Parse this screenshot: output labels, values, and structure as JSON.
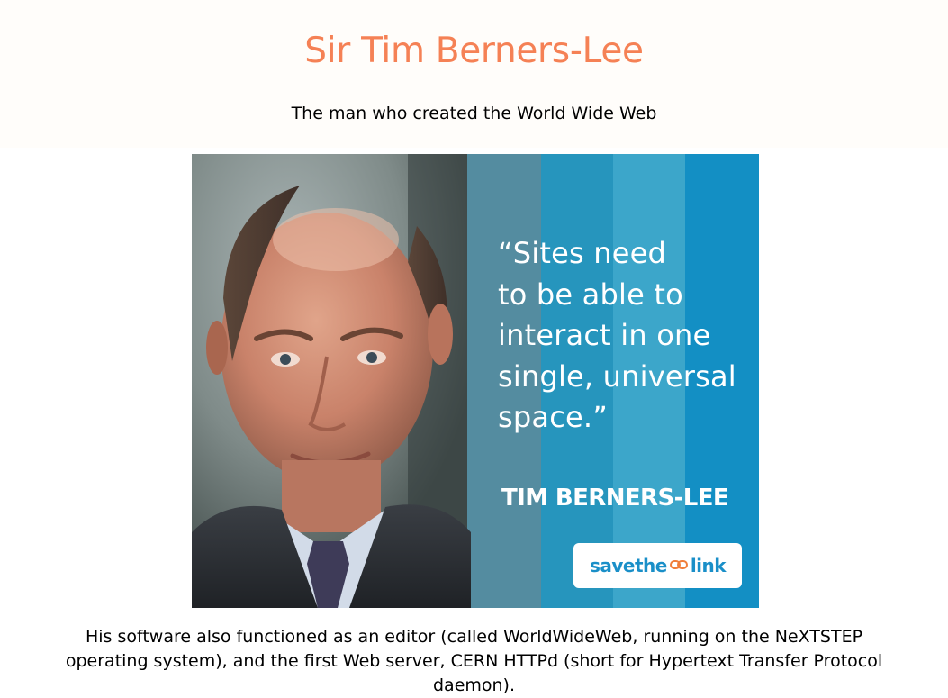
{
  "header": {
    "title": "Sir Tim Berners-Lee",
    "subtitle": "The man who created the World Wide Web"
  },
  "hero_image": {
    "quote": "“Sites need\nto be able to\ninteract in one\nsingle, universal\nspace.”",
    "author": "TIM BERNERS-LEE",
    "brand_before": "savethe",
    "brand_after": "link"
  },
  "article": {
    "text": "His software also functioned as an editor (called WorldWideWeb, running on the NeXTSTEP operating system), and the first Web server, CERN HTTPd (short for Hypertext Transfer Protocol daemon)."
  },
  "colors": {
    "title": "#f58155",
    "brand_blue": "#1a8fc8",
    "brand_orange": "#f07e3a"
  }
}
